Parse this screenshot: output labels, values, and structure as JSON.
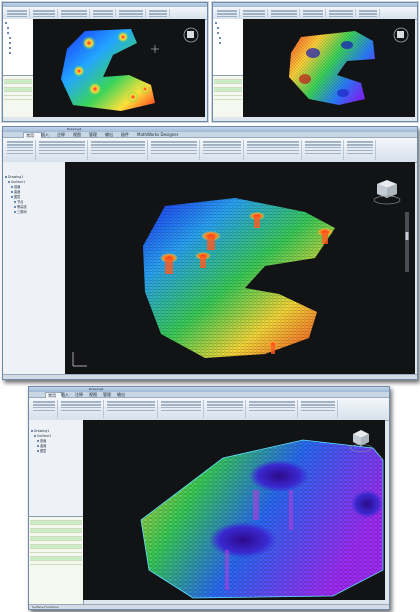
{
  "screens": [
    {
      "id": "view-top-left",
      "kind": "contour",
      "tabs": [],
      "doc_title": "",
      "status": ""
    },
    {
      "id": "view-top-right",
      "kind": "wireframe",
      "tabs": [],
      "doc_title": "",
      "status": ""
    },
    {
      "id": "view-middle",
      "kind": "mesh",
      "app_title": "Drawing1",
      "tabs": [
        "常用",
        "插入",
        "注释",
        "视图",
        "管理",
        "输出",
        "插件",
        "MathWorks Designer"
      ],
      "tree": {
        "root": "Drawing1",
        "items": [
          "Surface1",
          "剖面",
          "曲面",
          "图层",
          "节点",
          "等高线",
          "三角网"
        ]
      },
      "status": ""
    },
    {
      "id": "view-bottom",
      "kind": "closeup",
      "app_title": "Drawing1",
      "tabs": [
        "常用",
        "插入",
        "注释",
        "视图",
        "管理",
        "输出"
      ],
      "tree": {
        "root": "Drawing1",
        "items": [
          "Surface1",
          "剖面",
          "曲面",
          "图层"
        ]
      },
      "status": "Surface Functions"
    }
  ],
  "colors": {
    "contour_low": "#1a2cff",
    "contour_mid": "#32d35a",
    "contour_high": "#ff2a1e",
    "canvas_bg": "#121315",
    "ribbon": "#e6edf5"
  },
  "icons": [
    "viewcube-icon",
    "navigation-wheel-icon",
    "ucs-axis-icon"
  ]
}
